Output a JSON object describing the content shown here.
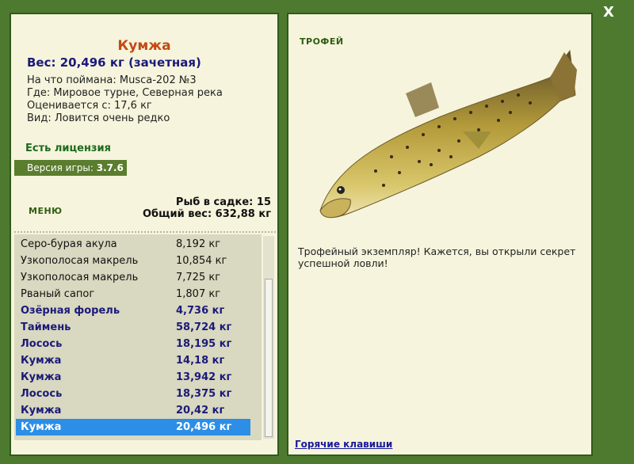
{
  "close_label": "X",
  "catch": {
    "title": "Кумжа",
    "weight_line": "Вес: 20,496 кг (зачетная)",
    "caught_with": "На что поймана: Musca-202 №3",
    "where": "Где: Мировое турне, Северная река",
    "valued": "Оценивается с: 17,6 кг",
    "kind": "Вид: Ловится очень редко"
  },
  "license": "Есть лицензия",
  "version_label": "Версия игры: ",
  "version_value": "3.7.6",
  "menu_label": "МЕНЮ",
  "fish_in_net": "Рыб в садке: 15",
  "total_weight": "Общий вес: 632,88 кг",
  "list": [
    {
      "name": "Серо-бурая акула",
      "weight": "8,192 кг"
    },
    {
      "name": "Узкополосая макрель",
      "weight": "10,854 кг"
    },
    {
      "name": "Узкополосая макрель",
      "weight": "7,725 кг"
    },
    {
      "name": "Рваный сапог",
      "weight": "1,807 кг"
    },
    {
      "name": "Озёрная форель",
      "weight": "4,736 кг"
    },
    {
      "name": "Таймень",
      "weight": "58,724 кг"
    },
    {
      "name": "Лосось",
      "weight": "18,195 кг"
    },
    {
      "name": "Кумжа",
      "weight": "14,18 кг"
    },
    {
      "name": "Кумжа",
      "weight": "13,942 кг"
    },
    {
      "name": "Лосось",
      "weight": "18,375 кг"
    },
    {
      "name": "Кумжа",
      "weight": "20,42 кг"
    },
    {
      "name": "Кумжа",
      "weight": "20,496 кг"
    }
  ],
  "trophy_label": "ТРОФЕЙ",
  "description": "Трофейный экземпляр! Кажется, вы открыли секрет успешной ловли!",
  "hotkeys": "Горячие клавиши",
  "colors": {
    "frame": "#4e7a30",
    "panel": "#f6f4dc",
    "selected": "#2c8ee6",
    "title": "#c34a14"
  }
}
